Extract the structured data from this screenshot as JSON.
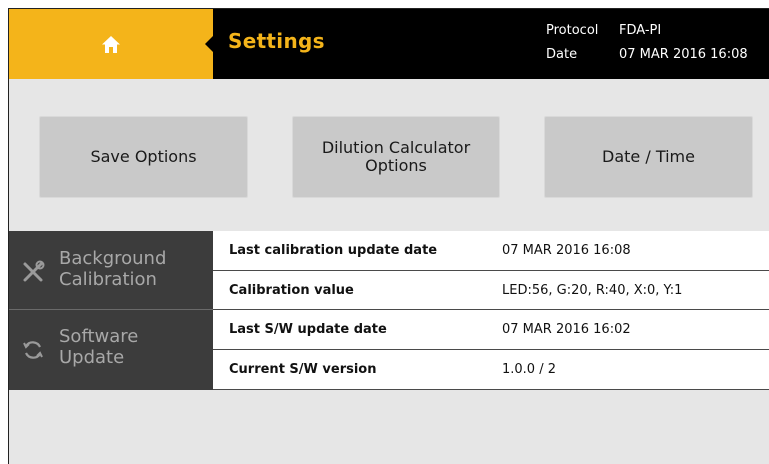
{
  "header": {
    "title": "Settings",
    "protocol_label": "Protocol",
    "protocol_value": "FDA-PI",
    "date_label": "Date",
    "date_value": "07 MAR 2016 16:08"
  },
  "options": {
    "save_label": "Save Options",
    "dilution_line1": "Dilution Calculator",
    "dilution_line2": "Options",
    "date_time_label": "Date / Time"
  },
  "sidebar": {
    "items": [
      {
        "line1": "Background",
        "line2": "Calibration",
        "icon": "wrench-screwdriver-icon"
      },
      {
        "line1": "Software",
        "line2": "Update",
        "icon": "refresh-icon"
      }
    ]
  },
  "table": {
    "rows": [
      {
        "label": "Last calibration update date",
        "value": "07 MAR 2016 16:08"
      },
      {
        "label": "Calibration value",
        "value": "LED:56, G:20, R:40, X:0, Y:1"
      },
      {
        "label": "Last S/W update date",
        "value": "07 MAR 2016 16:02"
      },
      {
        "label": "Current S/W version",
        "value": "1.0.0 / 2"
      }
    ]
  },
  "colors": {
    "accent": "#f4b41a",
    "header_bg": "#000000",
    "sidebar_bg": "#3c3c3c",
    "page_bg": "#e6e6e6",
    "button_bg": "#c9c9c9"
  }
}
